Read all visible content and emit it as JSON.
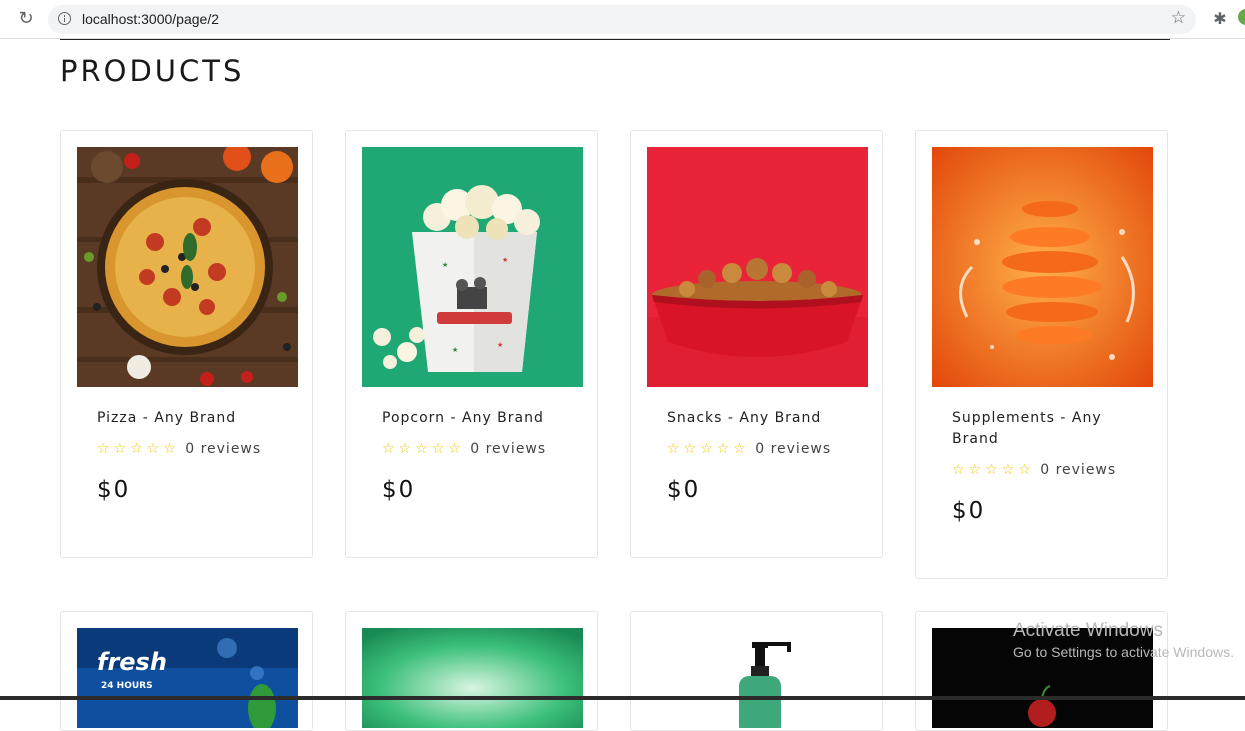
{
  "browser": {
    "url": "localhost:3000/page/2"
  },
  "page": {
    "title": "PRODUCTS"
  },
  "products": [
    {
      "name": "Pizza - Any Brand",
      "stars": "☆☆☆☆☆",
      "reviews": "0 reviews",
      "price": "$0"
    },
    {
      "name": "Popcorn - Any Brand",
      "stars": "☆☆☆☆☆",
      "reviews": "0 reviews",
      "price": "$0"
    },
    {
      "name": "Snacks - Any Brand",
      "stars": "☆☆☆☆☆",
      "reviews": "0 reviews",
      "price": "$0"
    },
    {
      "name": "Supplements - Any Brand",
      "stars": "☆☆☆☆☆",
      "reviews": "0 reviews",
      "price": "$0"
    }
  ],
  "second_row_images": {
    "fresh_text": "fresh",
    "fresh_sub": "24 HOURS"
  },
  "watermark": {
    "line1": "Activate Windows",
    "line2": "Go to Settings to activate Windows."
  },
  "colors": {
    "star": "#f2c500",
    "card_border": "#e5e5e5"
  }
}
